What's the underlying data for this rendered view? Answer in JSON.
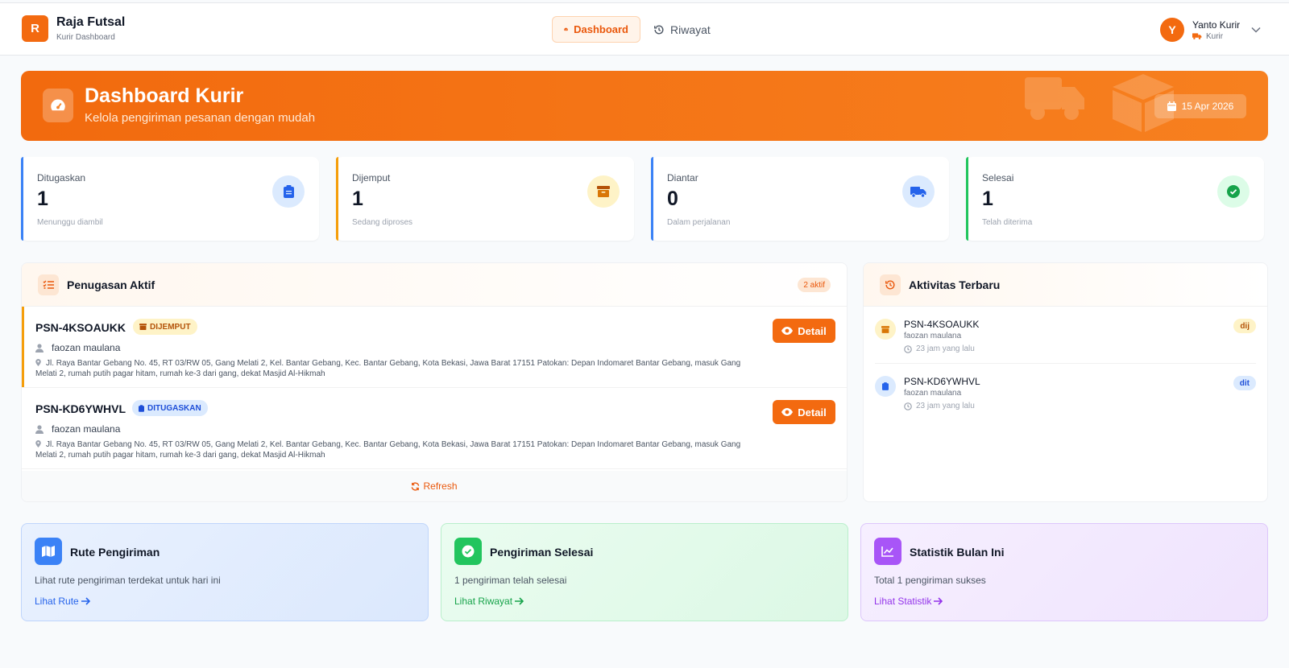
{
  "header": {
    "logo_letter": "R",
    "app_name": "Raja Futsal",
    "app_sub": "Kurir Dashboard",
    "nav": [
      {
        "label": "Dashboard",
        "active": true
      },
      {
        "label": "Riwayat",
        "active": false
      }
    ],
    "user": {
      "initial": "Y",
      "name": "Yanto Kurir",
      "role": "Kurir"
    }
  },
  "hero": {
    "title": "Dashboard Kurir",
    "subtitle": "Kelola pengiriman pesanan dengan mudah",
    "date": "15 Apr 2026"
  },
  "stats": [
    {
      "label": "Ditugaskan",
      "value": "1",
      "note": "Menunggu diambil",
      "color": "#3b82f6",
      "icon": "clipboard-list-icon"
    },
    {
      "label": "Dijemput",
      "value": "1",
      "note": "Sedang diproses",
      "color": "#f59e0b",
      "icon": "box-icon"
    },
    {
      "label": "Diantar",
      "value": "0",
      "note": "Dalam perjalanan",
      "color": "#3b82f6",
      "icon": "truck-icon"
    },
    {
      "label": "Selesai",
      "value": "1",
      "note": "Telah diterima",
      "color": "#22c55e",
      "icon": "check-circle-icon"
    }
  ],
  "assignments": {
    "title": "Penugasan Aktif",
    "count_badge": "2 aktif",
    "detail_label": "Detail",
    "refresh_label": "Refresh",
    "items": [
      {
        "code": "PSN-4KSOAUKK",
        "status": "DIJEMPUT",
        "customer": "faozan maulana",
        "address": "Jl. Raya Bantar Gebang No. 45, RT 03/RW 05, Gang Melati 2, Kel. Bantar Gebang, Kec. Bantar Gebang, Kota Bekasi, Jawa Barat 17151 Patokan: Depan Indomaret Bantar Gebang, masuk Gang Melati 2, rumah putih pagar hitam, rumah ke-3 dari gang, dekat Masjid Al-Hikmah"
      },
      {
        "code": "PSN-KD6YWHVL",
        "status": "DITUGASKAN",
        "customer": "faozan maulana",
        "address": "Jl. Raya Bantar Gebang No. 45, RT 03/RW 05, Gang Melati 2, Kel. Bantar Gebang, Kec. Bantar Gebang, Kota Bekasi, Jawa Barat 17151 Patokan: Depan Indomaret Bantar Gebang, masuk Gang Melati 2, rumah putih pagar hitam, rumah ke-3 dari gang, dekat Masjid Al-Hikmah"
      }
    ]
  },
  "activity": {
    "title": "Aktivitas Terbaru",
    "items": [
      {
        "code": "PSN-4KSOAUKK",
        "name": "faozan maulana",
        "time": "23 jam yang lalu",
        "tag": "dij"
      },
      {
        "code": "PSN-KD6YWHVL",
        "name": "faozan maulana",
        "time": "23 jam yang lalu",
        "tag": "dit"
      }
    ]
  },
  "cards": [
    {
      "title": "Rute Pengiriman",
      "desc": "Lihat rute pengiriman terdekat untuk hari ini",
      "link": "Lihat Rute",
      "icon": "map-icon",
      "accent": "#3b82f6"
    },
    {
      "title": "Pengiriman Selesai",
      "desc": "1 pengiriman telah selesai",
      "link": "Lihat Riwayat",
      "icon": "check-circle-icon",
      "accent": "#22c55e"
    },
    {
      "title": "Statistik Bulan Ini",
      "desc": "Total 1 pengiriman sukses",
      "link": "Lihat Statistik",
      "icon": "chart-line-icon",
      "accent": "#a855f7"
    }
  ]
}
